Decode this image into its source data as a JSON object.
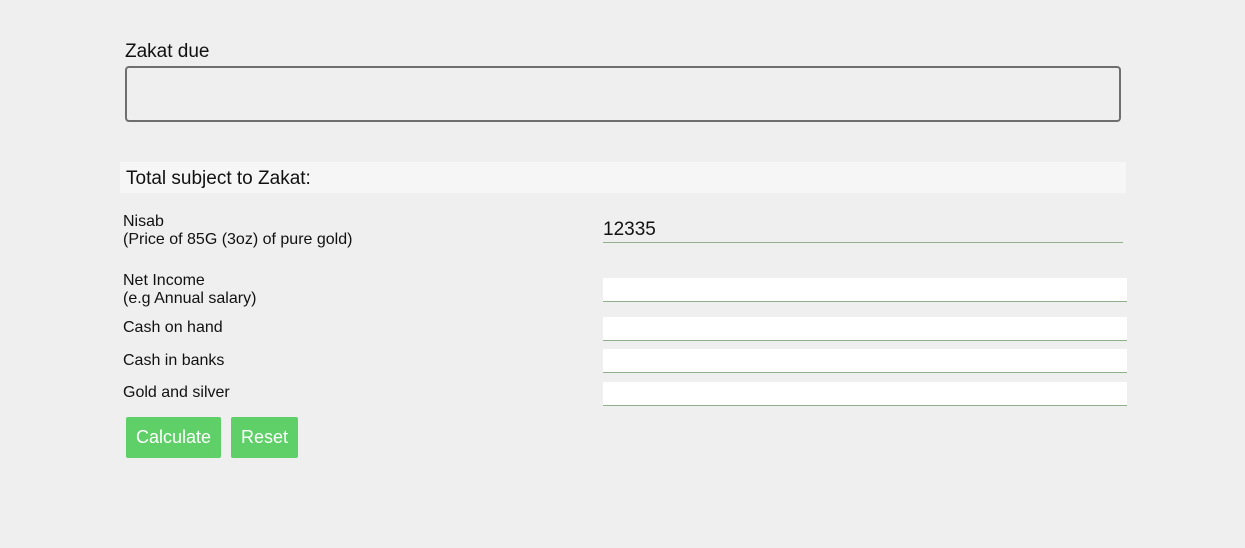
{
  "zakat_due": {
    "label": "Zakat due",
    "value": ""
  },
  "total": {
    "label": "Total subject to Zakat:"
  },
  "rows": {
    "nisab": {
      "label": "Nisab",
      "sublabel": "(Price of 85G (3oz) of pure gold)",
      "value": "12335"
    },
    "net_income": {
      "label": "Net Income",
      "sublabel": "(e.g Annual salary)",
      "value": ""
    },
    "cash_on_hand": {
      "label": "Cash on hand",
      "value": ""
    },
    "cash_in_banks": {
      "label": "Cash in banks",
      "value": ""
    },
    "gold_silver": {
      "label": "Gold and silver",
      "value": ""
    }
  },
  "buttons": {
    "calculate": "Calculate",
    "reset": "Reset"
  },
  "colors": {
    "background": "#efefef",
    "button_green": "#5fd068",
    "field_underline": "#8fb08a",
    "zakat_border": "#6f6f6f"
  }
}
